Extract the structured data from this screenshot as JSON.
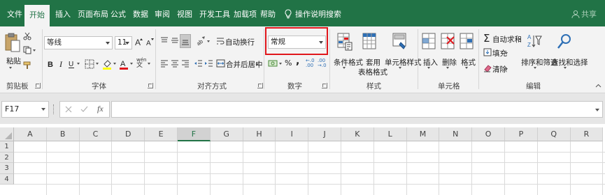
{
  "tabs": [
    {
      "label": "文件",
      "active": false
    },
    {
      "label": "开始",
      "active": true
    },
    {
      "label": "插入",
      "active": false
    },
    {
      "label": "页面布局",
      "active": false
    },
    {
      "label": "公式",
      "active": false
    },
    {
      "label": "数据",
      "active": false
    },
    {
      "label": "审阅",
      "active": false
    },
    {
      "label": "视图",
      "active": false
    },
    {
      "label": "开发工具",
      "active": false
    },
    {
      "label": "加载项",
      "active": false
    },
    {
      "label": "帮助",
      "active": false
    }
  ],
  "tell_me": {
    "label": "操作说明搜索",
    "icon": "lightbulb-icon"
  },
  "share": {
    "label": "共享",
    "icon": "person-icon"
  },
  "clipboard": {
    "paste_label": "粘贴",
    "group_label": "剪贴板"
  },
  "font": {
    "font_name": "等线",
    "font_size": "11",
    "group_label": "字体",
    "phonetic_label": "wén"
  },
  "alignment": {
    "wrap_text_label": "自动换行",
    "merge_label": "合并后居中",
    "group_label": "对齐方式"
  },
  "number": {
    "format_value": "常规",
    "group_label": "数字",
    "percent": "%",
    "comma": ",",
    "inc_decimal": "←.0 .00",
    "dec_decimal": ".00 →.0"
  },
  "styles": {
    "conditional_label": "条件格式",
    "table_label_1": "套用",
    "table_label_2": "表格格式",
    "cell_style_label": "单元格样式",
    "group_label": "样式"
  },
  "cells": {
    "insert_label": "插入",
    "delete_label": "删除",
    "format_label": "格式",
    "group_label": "单元格"
  },
  "editing": {
    "autosum_label": "自动求和",
    "fill_label": "填充",
    "clear_label": "清除",
    "sort_label": "排序和筛选",
    "find_label": "查找和选择",
    "group_label": "编辑"
  },
  "formula_bar": {
    "name_box": "F17",
    "fx": "fx",
    "formula": ""
  },
  "grid": {
    "columns": [
      "A",
      "B",
      "C",
      "D",
      "E",
      "F",
      "G",
      "H",
      "I",
      "J",
      "K",
      "L",
      "M",
      "N",
      "O",
      "P",
      "Q",
      "R"
    ],
    "rows": [
      "1",
      "2",
      "3",
      "4"
    ],
    "selected_column": "F"
  },
  "colors": {
    "accent": "#217346",
    "highlight": "#e0161b"
  }
}
